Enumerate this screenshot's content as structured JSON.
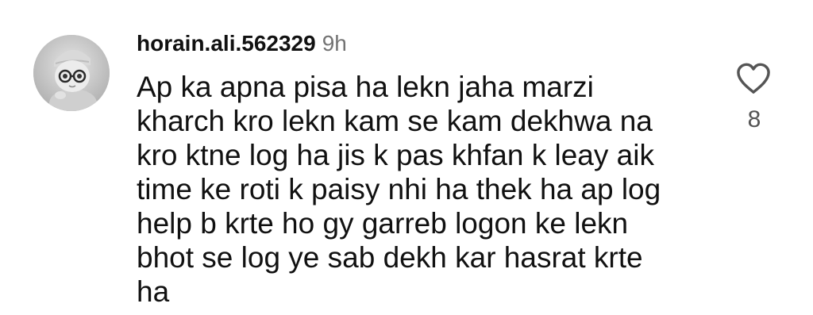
{
  "comment": {
    "username": "horain.ali.562329",
    "timestamp": "9h",
    "lines": [
      "Ap ka apna pisa ha lekn jaha marzi",
      "kharch kro lekn kam se kam dekhwa na",
      "kro ktne log ha jis k pas khfan k leay aik",
      "time ke roti k paisy nhi ha thek ha ap log",
      "help b krte ho gy garreb logon ke lekn",
      "bhot se log ye sab dekh kar hasrat krte",
      "ha"
    ],
    "like_count": "8",
    "like_icon": "heart-outline-icon",
    "avatar_icon": "doll-with-glasses-avatar"
  },
  "colors": {
    "text_primary": "#111111",
    "text_secondary": "#737373",
    "like_count": "#555555",
    "heart_stroke": "#555555"
  }
}
